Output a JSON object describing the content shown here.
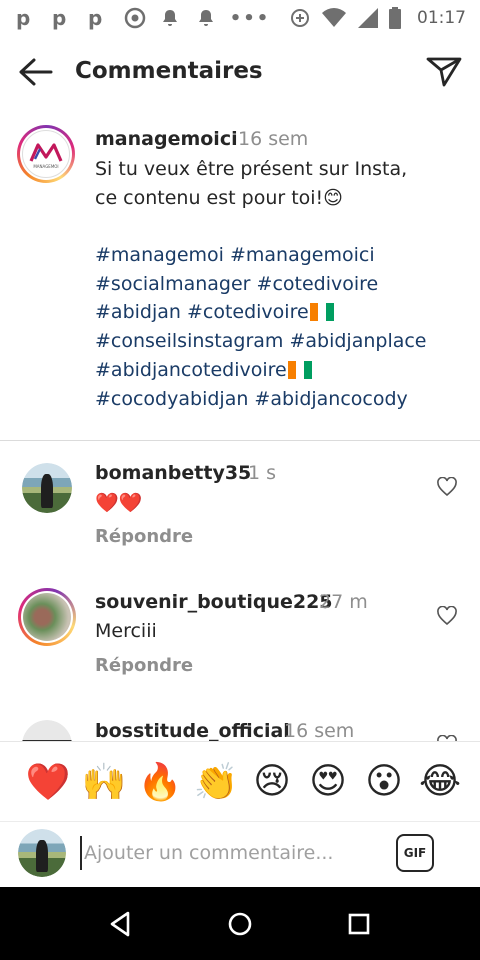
{
  "status_bar": {
    "left_icons": [
      "p-icon",
      "p-icon",
      "p-icon",
      "chrome-icon",
      "notification-icon",
      "notification-icon",
      "more-dots-icon"
    ],
    "time": "01:17"
  },
  "header": {
    "title": "Commentaires"
  },
  "caption": {
    "username": "managemoici",
    "time": "16 sem",
    "text_line1": "Si tu veux être présent sur Insta,",
    "text_line2": "ce contenu est pour toi!😊",
    "hashtag_lines": [
      "#managemoi #managemoici",
      "#socialmanager #cotedivoire",
      "#abidjan #cotedivoire",
      "#conseilsinstagram #abidjanplace",
      "#abidjancotedivoire",
      "#cocodyabidjan #abidjancocody"
    ],
    "logo_text": "MANAGEMOI"
  },
  "comments": [
    {
      "username": "bomanbetty35",
      "time": "1 s",
      "text": "❤️❤️",
      "reply": "Répondre"
    },
    {
      "username": "souvenir_boutique225",
      "time": "27 m",
      "text": "Merciii",
      "reply": "Répondre"
    },
    {
      "username": "bosstitude_official",
      "time": "16 sem",
      "text": "",
      "reply": ""
    }
  ],
  "reactions": [
    "❤️",
    "🙌",
    "🔥",
    "👏",
    "😢",
    "😍",
    "😮",
    "😂"
  ],
  "composer": {
    "placeholder": "Ajouter un commentaire...",
    "gif_label": "GIF"
  },
  "colors": {
    "hashtag": "#1a3b66",
    "muted": "#8e8e8e",
    "text": "#262626"
  }
}
